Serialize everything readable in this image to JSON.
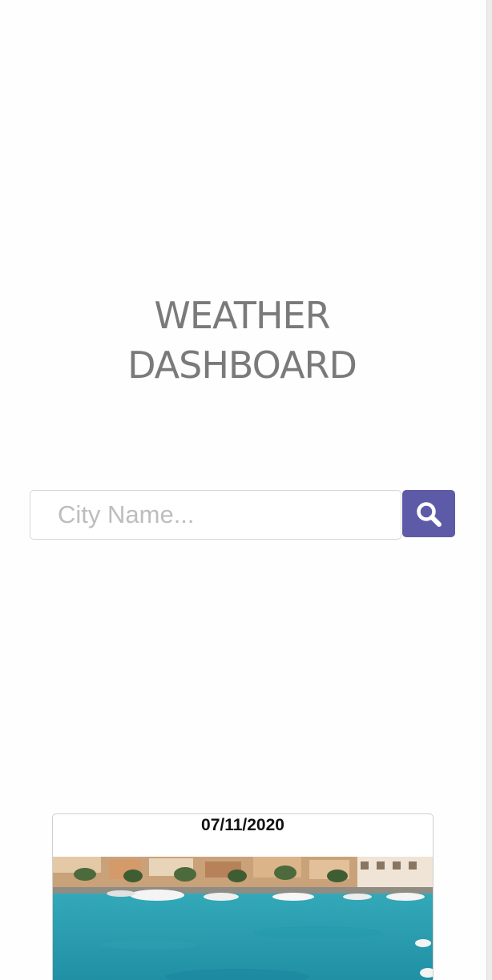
{
  "header": {
    "title_line1": "WEATHER",
    "title_line2": "DASHBOARD"
  },
  "search": {
    "placeholder": "City Name...",
    "value": "",
    "button_icon": "search-icon"
  },
  "forecast_card": {
    "date": "07/11/2020",
    "image_subject": "harbor-photo"
  },
  "colors": {
    "accent": "#5d5ba8",
    "title": "#7a7a7a",
    "water": "#2aa3b3"
  }
}
